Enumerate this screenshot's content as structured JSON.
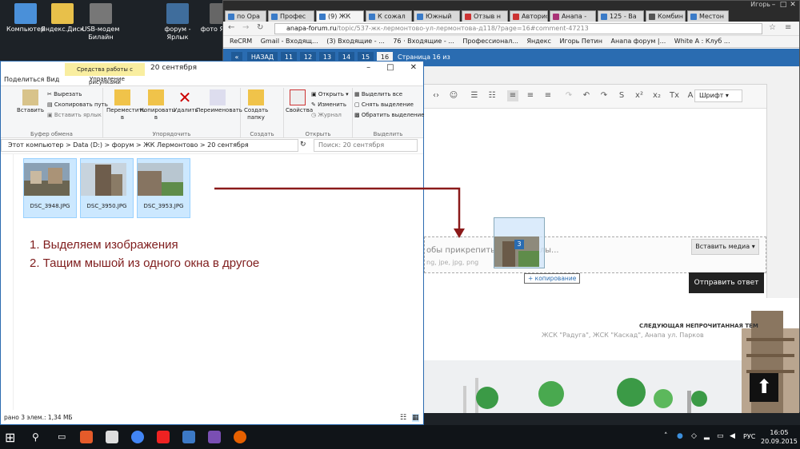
{
  "desktop": {
    "icons": [
      {
        "label": "Компьютер",
        "color": "#4a90d9"
      },
      {
        "label": "Яндекс.Диск",
        "color": "#e8c04a"
      },
      {
        "label": "USB-модем Билайн",
        "color": "#777777"
      },
      {
        "label": "форум - Ярлык",
        "color": "#3f6d9c"
      },
      {
        "label": "фото Ярлык",
        "color": "#666666"
      }
    ]
  },
  "chrome": {
    "user": "Игорь",
    "tabs": [
      {
        "label": "по Ора"
      },
      {
        "label": "Профес"
      },
      {
        "label": "(9) ЖК",
        "active": true
      },
      {
        "label": "К сожал"
      },
      {
        "label": "Южный"
      },
      {
        "label": "Отзыв н"
      },
      {
        "label": "Авторис"
      },
      {
        "label": "Анапа -"
      },
      {
        "label": "125 - Ва"
      },
      {
        "label": "Комбин"
      },
      {
        "label": "Местон"
      }
    ],
    "url_host": "anapa-forum.ru",
    "url_path": "/topic/537-жк-лермонтово-ул-лермонтова-д118/?page=16#comment-47213",
    "bookmarks": [
      "ReCRM",
      "Gmail - Входящ...",
      "(3) Входящие - ...",
      "76 · Входящие - ...",
      "Профессионал...",
      "Яндекс",
      "Игорь Петин",
      "Анапа форум |...",
      "White A : Клуб ..."
    ],
    "pager": {
      "back": "НАЗАД",
      "pages": [
        "11",
        "12",
        "13",
        "14",
        "15",
        "16"
      ],
      "current": "16",
      "info": "Страница 16 из 16"
    },
    "editor": {
      "font_label": "Шрифт",
      "drop_text": "обы прикрепить и     ите файлы...",
      "drop_hint": "ng, jpe, jpg, png",
      "insert_media": "Вставить медиа",
      "send": "Отправить ответ"
    },
    "next_topic": {
      "heading": "СЛЕДУЮЩАЯ НЕПРОЧИТАННАЯ ТЕМ",
      "title": "ЖСК \"Радуга\", ЖСК \"Каскад\", Анапа ул. Парков"
    }
  },
  "explorer": {
    "context_tab": "Средства работы с рисунками",
    "title": "20 сентября",
    "ribbon_tabs": [
      "Поделиться",
      "Вид",
      "Управление"
    ],
    "groups": {
      "clipboard": {
        "label": "Буфер обмена",
        "cut": "Вырезать",
        "copy_path": "Скопировать путь",
        "paste_shortcut": "Вставить ярлык",
        "paste": "Вставить"
      },
      "organize": {
        "label": "Упорядочить",
        "move": "Переместить в",
        "copy": "Копировать в",
        "delete": "Удалить",
        "rename": "Переименовать"
      },
      "new": {
        "label": "Создать",
        "folder": "Создать папку"
      },
      "open": {
        "label": "Открыть",
        "props": "Свойства",
        "open": "Открыть",
        "edit": "Изменить",
        "history": "Журнал"
      },
      "select": {
        "label": "Выделить",
        "all": "Выделить все",
        "none": "Снять выделение",
        "invert": "Обратить выделение"
      }
    },
    "breadcrumb": [
      "Этот компьютер",
      "Data (D:)",
      "форум",
      "ЖК Лермонтово",
      "20 сентября"
    ],
    "search_placeholder": "Поиск: 20 сентября",
    "files": [
      "DSC_3948.JPG",
      "DSC_3950.JPG",
      "DSC_3953.JPG"
    ],
    "status": "рано 3 элем.: 1,34 МБ",
    "instructions": [
      "1. Выделяем изображения",
      "2. Тащим мышой из одного окна в другое"
    ]
  },
  "drag": {
    "count": "3",
    "tooltip": "копирование"
  },
  "taskbar": {
    "lang": "РУС",
    "time": "16:05",
    "date": "20.09.2015"
  },
  "colors": {
    "accent": "#2a6cb1",
    "arrow": "#8b1a1a",
    "instruction_text": "#7f1d1d"
  }
}
